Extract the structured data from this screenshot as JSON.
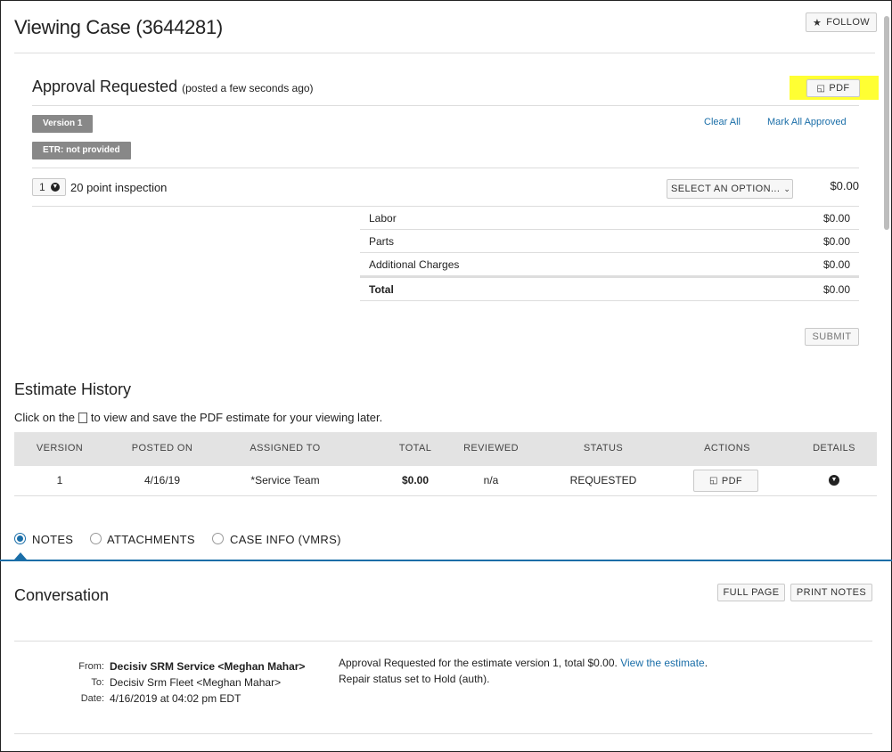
{
  "header": {
    "title": "Viewing Case (3644281)",
    "follow_label": "FOLLOW"
  },
  "approval": {
    "heading": "Approval Requested",
    "posted": "(posted a few seconds ago)",
    "pdf_label": "PDF",
    "version_badge": "Version 1",
    "etr_badge": "ETR: not provided",
    "clear_all": "Clear All",
    "mark_all_approved": "Mark All Approved",
    "line_item": {
      "quantity": "1",
      "name": "20 point inspection",
      "select_value": "SELECT AN OPTION...",
      "amount": "$0.00"
    },
    "breakdown": [
      {
        "label": "Labor",
        "amount": "$0.00"
      },
      {
        "label": "Parts",
        "amount": "$0.00"
      },
      {
        "label": "Additional Charges",
        "amount": "$0.00"
      }
    ],
    "total_label": "Total",
    "total_amount": "$0.00",
    "submit_label": "SUBMIT"
  },
  "estimate_history": {
    "heading": "Estimate History",
    "instruction_pre": "Click on the",
    "instruction_post": "to view and save the PDF estimate for your viewing later.",
    "columns": [
      "VERSION",
      "POSTED ON",
      "ASSIGNED TO",
      "TOTAL",
      "REVIEWED",
      "STATUS",
      "ACTIONS",
      "DETAILS"
    ],
    "rows": [
      {
        "version": "1",
        "posted_on": "4/16/19",
        "assigned_to": "*Service Team",
        "total": "$0.00",
        "reviewed": "n/a",
        "status": "REQUESTED",
        "action_label": "PDF"
      }
    ]
  },
  "tabs": [
    {
      "label": "NOTES",
      "selected": true
    },
    {
      "label": "ATTACHMENTS",
      "selected": false
    },
    {
      "label": "CASE INFO (VMRS)",
      "selected": false
    }
  ],
  "conversation": {
    "heading": "Conversation",
    "full_page_label": "FULL PAGE",
    "print_notes_label": "PRINT NOTES",
    "from_label": "From:",
    "from_value": "Decisiv SRM Service <Meghan Mahar>",
    "to_label": "To:",
    "to_value": "Decisiv Srm Fleet <Meghan Mahar>",
    "date_label": "Date:",
    "date_value": "4/16/2019 at 04:02 pm EDT",
    "message_line1": "Approval Requested for the estimate version 1, total $0.00.",
    "message_link": "View the estimate",
    "message_period": ".",
    "message_line2": "Repair status set to Hold (auth)."
  },
  "colors": {
    "accent": "#1a6ea8",
    "highlight": "#ffff33",
    "badge": "#888888",
    "table_header": "#e3e3e3"
  }
}
